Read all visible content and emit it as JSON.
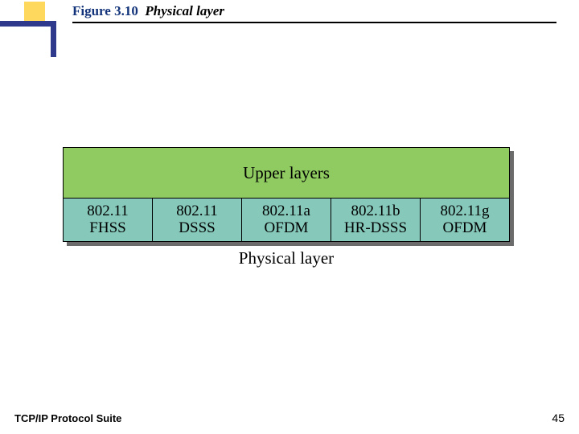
{
  "title": {
    "figure": "Figure 3.10",
    "label": "Physical layer"
  },
  "diagram": {
    "upper_label": "Upper layers",
    "caption": "Physical layer",
    "cells": [
      {
        "line1": "802.11",
        "line2": "FHSS"
      },
      {
        "line1": "802.11",
        "line2": "DSSS"
      },
      {
        "line1": "802.11a",
        "line2": "OFDM"
      },
      {
        "line1": "802.11b",
        "line2": "HR-DSSS"
      },
      {
        "line1": "802.11g",
        "line2": "OFDM"
      }
    ]
  },
  "footer": {
    "left": "TCP/IP Protocol Suite",
    "page": "45"
  }
}
